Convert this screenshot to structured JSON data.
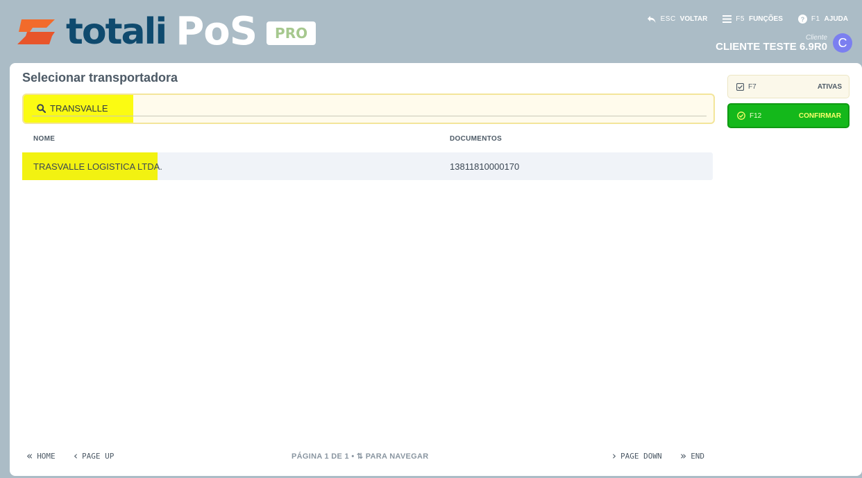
{
  "header": {
    "logo": {
      "word1": "totali",
      "word2": "PoS",
      "badge": "PRO"
    },
    "nav": [
      {
        "key": "ESC",
        "label": "VOLTAR",
        "icon": "undo-arrow-icon"
      },
      {
        "key": "F5",
        "label": "FUNÇÕES",
        "icon": "menu-lines-icon"
      },
      {
        "key": "F1",
        "label": "AJUDA",
        "icon": "help-circle-icon"
      }
    ],
    "user": {
      "label": "Cliente",
      "name": "CLIENTE TESTE 6.9R0",
      "initial": "C"
    }
  },
  "page": {
    "title": "Selecionar transportadora",
    "search": {
      "value": "TRANSVALLE"
    },
    "columns": {
      "name": "NOME",
      "documents": "DOCUMENTOS"
    },
    "rows": [
      {
        "name": "TRASVALLE LOGISTICA LTDA.",
        "document": "13811810000170"
      }
    ],
    "pagination": {
      "home": "HOME",
      "page_up": "PAGE UP",
      "info": "PÁGINA  1  DE  1  •  ⇅ PARA NAVEGAR",
      "page_down": "PAGE DOWN",
      "end": "END"
    }
  },
  "actions": {
    "ativas": {
      "key": "F7",
      "label": "ATIVAS"
    },
    "confirmar": {
      "key": "F12",
      "label": "CONFIRMAR"
    }
  },
  "colors": {
    "background": "#abbcc6",
    "brand_orange": "#f26b2b",
    "brand_blue": "#0f4a6e",
    "highlight_yellow": "#f2f211",
    "confirm_green": "#14b81b",
    "avatar": "#7b7ff0"
  }
}
